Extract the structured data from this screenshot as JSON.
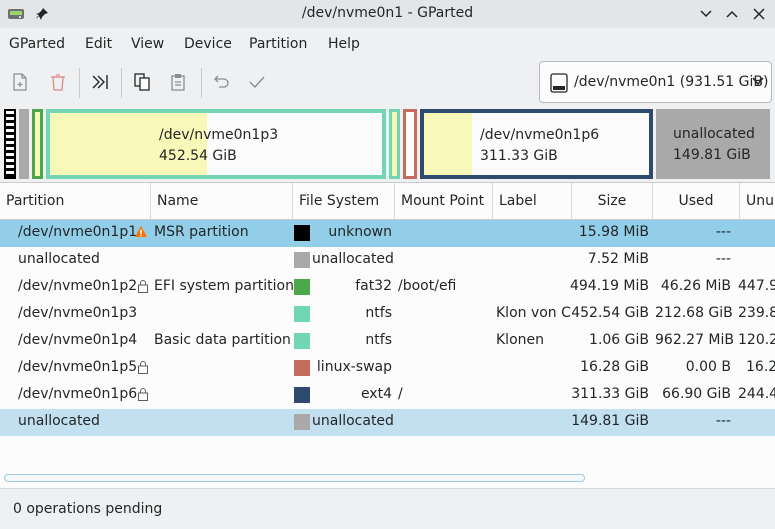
{
  "window": {
    "title": "/dev/nvme0n1 - GParted"
  },
  "menubar": {
    "items": [
      "GParted",
      "Edit",
      "View",
      "Device",
      "Partition",
      "Help"
    ]
  },
  "toolbar": {
    "buttons": [
      "new-icon",
      "delete-icon",
      "resize-move-icon",
      "copy-icon",
      "paste-icon",
      "undo-icon",
      "apply-icon"
    ]
  },
  "device": {
    "selected": "/dev/nvme0n1 (931.51 GiB)"
  },
  "partition_map": {
    "p3": {
      "name": "/dev/nvme0n1p3",
      "size": "452.54 GiB"
    },
    "p6": {
      "name": "/dev/nvme0n1p6",
      "size": "311.33 GiB"
    },
    "unalloc": {
      "name": "unallocated",
      "size": "149.81 GiB"
    }
  },
  "table": {
    "headers": [
      "Partition",
      "Name",
      "File System",
      "Mount Point",
      "Label",
      "Size",
      "Used",
      "Unu"
    ],
    "rows": [
      {
        "partition": "/dev/nvme0n1p1",
        "name": "MSR partition",
        "fs": "unknown",
        "fs_color": "#000000",
        "mount": "",
        "label": "",
        "size": "15.98 MiB",
        "used": "---",
        "unused": ""
      },
      {
        "partition": "unallocated",
        "name": "",
        "fs": "unallocated",
        "fs_color": "#a9a9a9",
        "mount": "",
        "label": "",
        "size": "7.52 MiB",
        "used": "---",
        "unused": ""
      },
      {
        "partition": "/dev/nvme0n1p2",
        "name": "EFI system partition",
        "fs": "fat32",
        "fs_color": "#4aa84a",
        "mount": "/boot/efi",
        "label": "",
        "size": "494.19 MiB",
        "used": "46.26 MiB",
        "unused": "447.9"
      },
      {
        "partition": "/dev/nvme0n1p3",
        "name": "",
        "fs": "ntfs",
        "fs_color": "#72d5b4",
        "mount": "",
        "label": "Klon von C",
        "size": "452.54 GiB",
        "used": "212.68 GiB",
        "unused": "239.8"
      },
      {
        "partition": "/dev/nvme0n1p4",
        "name": "Basic data partition",
        "fs": "ntfs",
        "fs_color": "#72d5b4",
        "mount": "",
        "label": "Klonen",
        "size": "1.06 GiB",
        "used": "962.27 MiB",
        "unused": "120.2"
      },
      {
        "partition": "/dev/nvme0n1p5",
        "name": "",
        "fs": "linux-swap",
        "fs_color": "#c56c5f",
        "mount": "",
        "label": "",
        "size": "16.28 GiB",
        "used": "0.00 B",
        "unused": "16.2"
      },
      {
        "partition": "/dev/nvme0n1p6",
        "name": "",
        "fs": "ext4",
        "fs_color": "#2e4a6c",
        "mount": "/",
        "label": "",
        "size": "311.33 GiB",
        "used": "66.90 GiB",
        "unused": "244.4"
      },
      {
        "partition": "unallocated",
        "name": "",
        "fs": "unallocated",
        "fs_color": "#a9a9a9",
        "mount": "",
        "label": "",
        "size": "149.81 GiB",
        "used": "---",
        "unused": ""
      }
    ]
  },
  "status": {
    "text": "0 operations pending"
  }
}
